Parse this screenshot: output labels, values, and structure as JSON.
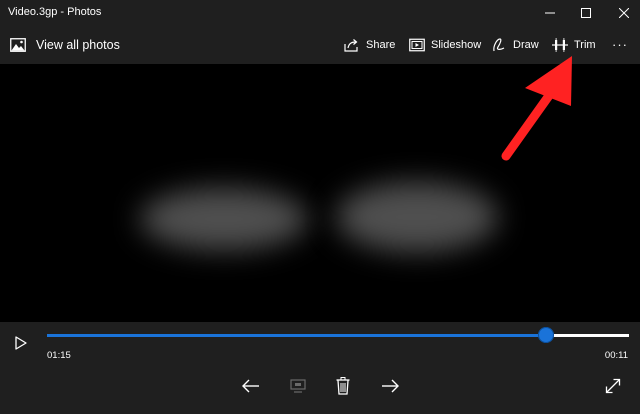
{
  "window": {
    "title": "Video.3gp - Photos"
  },
  "toolbar": {
    "view_all": {
      "label": "View all photos",
      "icon": "photos-icon"
    },
    "commands": [
      {
        "label": "Share",
        "icon": "share-icon"
      },
      {
        "label": "Slideshow",
        "icon": "slideshow-icon"
      },
      {
        "label": "Draw",
        "icon": "draw-pen-icon"
      },
      {
        "label": "Trim",
        "icon": "trim-icon"
      }
    ],
    "more": {
      "icon": "more-ellipsis-icon",
      "label": "···"
    }
  },
  "annotation": {
    "arrow_color": "#ff2222",
    "target": "Trim"
  },
  "player": {
    "current_time": "01:15",
    "remaining_time": "00:11",
    "progress": 0.858,
    "accent_color": "#1a73d9",
    "controls": [
      "play-icon",
      "arrow-left-icon",
      "rotate-icon",
      "delete-icon",
      "arrow-right-icon",
      "fullscreen-icon"
    ]
  }
}
